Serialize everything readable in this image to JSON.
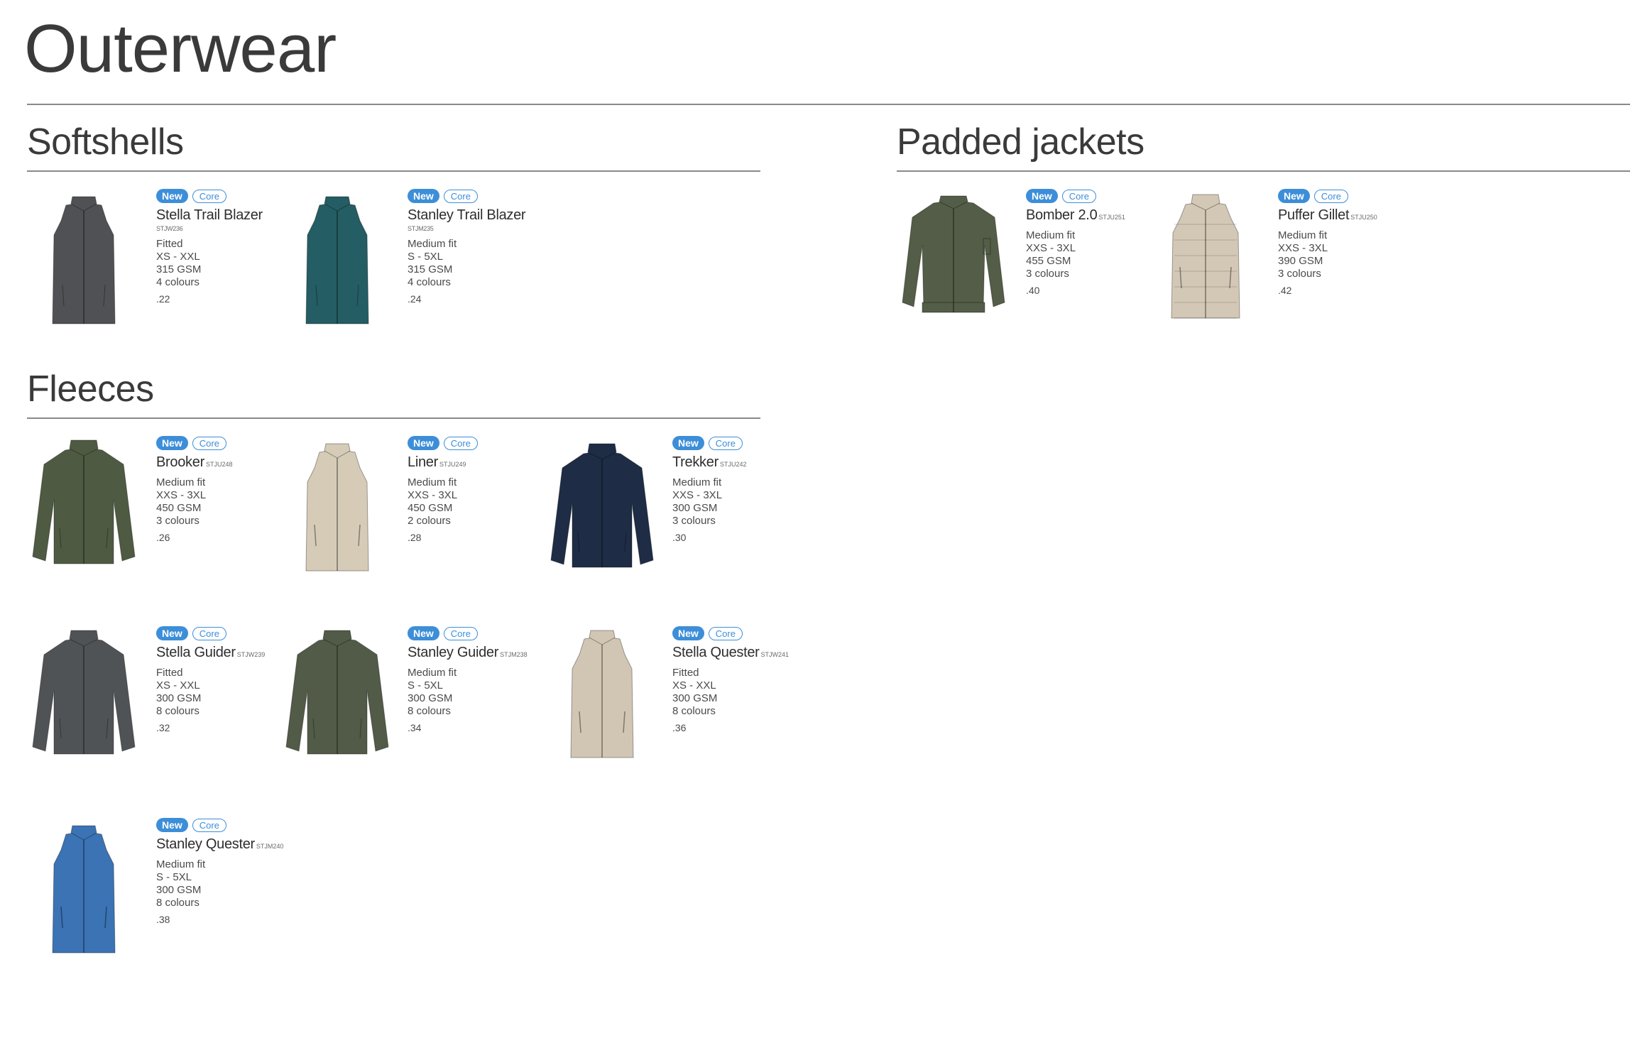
{
  "page_title": "Outerwear",
  "badges": {
    "new": "New",
    "core": "Core"
  },
  "sections": {
    "softshells": {
      "title": "Softshells",
      "products": [
        {
          "name": "Stella Trail Blazer",
          "code": "STJW236",
          "fit": "Fitted",
          "sizes": "XS - XXL",
          "weight": "315 GSM",
          "colours": "4 colours",
          "page": ".22",
          "color": "#4f5154",
          "icon": "vest-icon"
        },
        {
          "name": "Stanley Trail Blazer",
          "code": "STJM235",
          "fit": "Medium fit",
          "sizes": "S - 5XL",
          "weight": "315 GSM",
          "colours": "4 colours",
          "page": ".24",
          "color": "#245d63",
          "icon": "vest-icon"
        }
      ]
    },
    "padded": {
      "title": "Padded jackets",
      "products": [
        {
          "name": "Bomber 2.0",
          "code": "STJU251",
          "fit": "Medium fit",
          "sizes": "XXS - 3XL",
          "weight": "455 GSM",
          "colours": "3 colours",
          "page": ".40",
          "color": "#535d47",
          "icon": "bomber-jacket-icon"
        },
        {
          "name": "Puffer Gillet",
          "code": "STJU250",
          "fit": "Medium fit",
          "sizes": "XXS - 3XL",
          "weight": "390 GSM",
          "colours": "3 colours",
          "page": ".42",
          "color": "#d3c8b6",
          "icon": "puffer-vest-icon"
        }
      ]
    },
    "fleeces": {
      "title": "Fleeces",
      "products": [
        {
          "name": "Brooker",
          "code": "STJU248",
          "fit": "Medium fit",
          "sizes": "XXS - 3XL",
          "weight": "450 GSM",
          "colours": "3 colours",
          "page": ".26",
          "color": "#4f5a42",
          "icon": "fleece-jacket-icon"
        },
        {
          "name": "Liner",
          "code": "STJU249",
          "fit": "Medium fit",
          "sizes": "XXS - 3XL",
          "weight": "450 GSM",
          "colours": "2 colours",
          "page": ".28",
          "color": "#d6cbb7",
          "icon": "fleece-vest-icon"
        },
        {
          "name": "Trekker",
          "code": "STJU242",
          "fit": "Medium fit",
          "sizes": "XXS - 3XL",
          "weight": "300 GSM",
          "colours": "3 colours",
          "page": ".30",
          "color": "#1e2c45",
          "icon": "fleece-jacket-icon"
        },
        {
          "name": "Stella Guider",
          "code": "STJW239",
          "fit": "Fitted",
          "sizes": "XS - XXL",
          "weight": "300 GSM",
          "colours": "8 colours",
          "page": ".32",
          "color": "#505356",
          "icon": "fleece-jacket-icon"
        },
        {
          "name": "Stanley Guider",
          "code": "STJM238",
          "fit": "Medium fit",
          "sizes": "S - 5XL",
          "weight": "300 GSM",
          "colours": "8 colours",
          "page": ".34",
          "color": "#525b47",
          "icon": "fleece-jacket-icon"
        },
        {
          "name": "Stella Quester",
          "code": "STJW241",
          "fit": "Fitted",
          "sizes": "XS - XXL",
          "weight": "300 GSM",
          "colours": "8 colours",
          "page": ".36",
          "color": "#d1c6b4",
          "icon": "fleece-vest-icon"
        },
        {
          "name": "Stanley Quester",
          "code": "STJM240",
          "fit": "Medium fit",
          "sizes": "S - 5XL",
          "weight": "300 GSM",
          "colours": "8 colours",
          "page": ".38",
          "color": "#3b73b4",
          "icon": "fleece-vest-icon"
        }
      ]
    }
  }
}
